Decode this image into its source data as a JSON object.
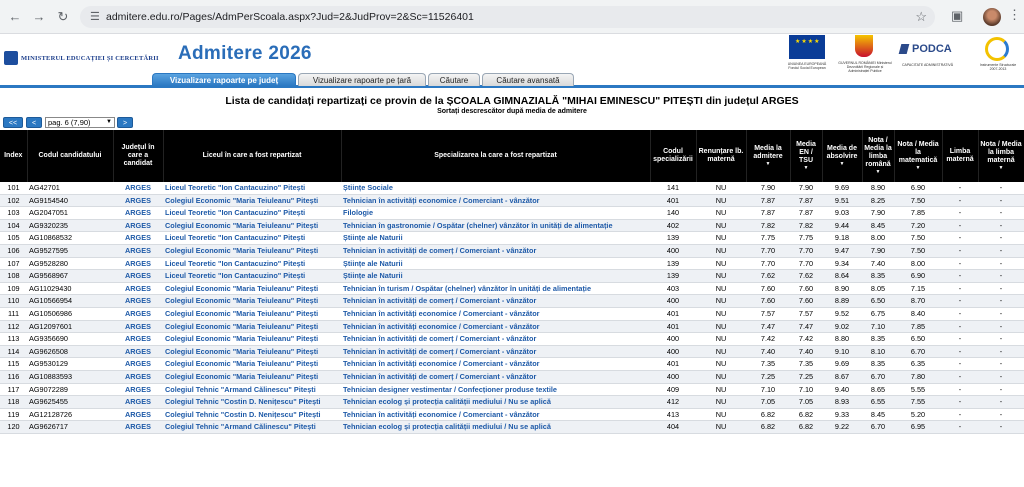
{
  "browser": {
    "url": "admitere.edu.ro/Pages/AdmPerScoala.aspx?Jud=2&JudProv=2&Sc=11526401"
  },
  "header": {
    "ministry": "MINISTERUL EDUCAȚIEI ȘI CERCETĂRII",
    "title": "Admitere 2026",
    "logo_eu_caption": "UNIUNEA EUROPEANĂ Fondul Social European",
    "logo_gov_caption": "GUVERNUL ROMÂNIEI Ministerul Dezvoltării Regionale și Administrației Publice",
    "logo_podca": "PODCA",
    "logo_podca_caption": "CAPACITATE ADMINISTRATIVĂ",
    "logo_inst_caption": "Instrumente Structurale 2007-2013"
  },
  "tabs": [
    {
      "label": "Vizualizare rapoarte pe județ",
      "active": true
    },
    {
      "label": "Vizualizare rapoarte pe țară",
      "active": false
    },
    {
      "label": "Căutare",
      "active": false
    },
    {
      "label": "Căutare avansată",
      "active": false
    }
  ],
  "list": {
    "title": "Lista de candidați repartizați ce provin de la ȘCOALA GIMNAZIALĂ \"MIHAI EMINESCU\" PITEȘTI din județul ARGES",
    "subtitle": "Sortați descrescător după media de admitere"
  },
  "pager": {
    "first": "<<",
    "prev": "<",
    "selected_page": "pag. 6 (7,90)",
    "next": ">"
  },
  "columns": [
    "Index",
    "Codul candidatului",
    "Județul în care a candidat",
    "Liceul în care a fost repartizat",
    "Specializarea la care a fost repartizat",
    "Codul specializării",
    "Renunțare lb. maternă",
    "Media la admitere",
    "Media EN / TSU",
    "Media de absolvire",
    "Nota / Media la limba română",
    "Nota / Media la matematică",
    "Limba maternă",
    "Nota / Media la limba maternă"
  ],
  "rows": [
    [
      "101",
      "AG42701",
      "ARGES",
      "Liceul Teoretic \"Ion Cantacuzino\" Pitești",
      "Științe Sociale",
      "141",
      "NU",
      "7.90",
      "7.90",
      "9.69",
      "8.90",
      "6.90",
      "-",
      "-"
    ],
    [
      "102",
      "AG9154540",
      "ARGES",
      "Colegiul Economic \"Maria Teiuleanu\" Pitești",
      "Tehnician în activități economice / Comerciant - vânzător",
      "401",
      "NU",
      "7.87",
      "7.87",
      "9.51",
      "8.25",
      "7.50",
      "-",
      "-"
    ],
    [
      "103",
      "AG2047051",
      "ARGES",
      "Liceul Teoretic \"Ion Cantacuzino\" Pitești",
      "Filologie",
      "140",
      "NU",
      "7.87",
      "7.87",
      "9.03",
      "7.90",
      "7.85",
      "-",
      "-"
    ],
    [
      "104",
      "AG9320235",
      "ARGES",
      "Colegiul Economic \"Maria Teiuleanu\" Pitești",
      "Tehnician în gastronomie / Ospătar (chelner) vânzător în unități de alimentație",
      "402",
      "NU",
      "7.82",
      "7.82",
      "9.44",
      "8.45",
      "7.20",
      "-",
      "-"
    ],
    [
      "105",
      "AG10868532",
      "ARGES",
      "Liceul Teoretic \"Ion Cantacuzino\" Pitești",
      "Științe ale Naturii",
      "139",
      "NU",
      "7.75",
      "7.75",
      "9.18",
      "8.00",
      "7.50",
      "-",
      "-"
    ],
    [
      "106",
      "AG9527595",
      "ARGES",
      "Colegiul Economic \"Maria Teiuleanu\" Pitești",
      "Tehnician în activități de comerț / Comerciant - vânzător",
      "400",
      "NU",
      "7.70",
      "7.70",
      "9.47",
      "7.90",
      "7.50",
      "-",
      "-"
    ],
    [
      "107",
      "AG9528280",
      "ARGES",
      "Liceul Teoretic \"Ion Cantacuzino\" Pitești",
      "Științe ale Naturii",
      "139",
      "NU",
      "7.70",
      "7.70",
      "9.34",
      "7.40",
      "8.00",
      "-",
      "-"
    ],
    [
      "108",
      "AG9568967",
      "ARGES",
      "Liceul Teoretic \"Ion Cantacuzino\" Pitești",
      "Științe ale Naturii",
      "139",
      "NU",
      "7.62",
      "7.62",
      "8.64",
      "8.35",
      "6.90",
      "-",
      "-"
    ],
    [
      "109",
      "AG11029430",
      "ARGES",
      "Colegiul Economic \"Maria Teiuleanu\" Pitești",
      "Tehnician în turism / Ospătar (chelner) vânzător în unități de alimentație",
      "403",
      "NU",
      "7.60",
      "7.60",
      "8.90",
      "8.05",
      "7.15",
      "-",
      "-"
    ],
    [
      "110",
      "AG10566954",
      "ARGES",
      "Colegiul Economic \"Maria Teiuleanu\" Pitești",
      "Tehnician în activități de comerț / Comerciant - vânzător",
      "400",
      "NU",
      "7.60",
      "7.60",
      "8.89",
      "6.50",
      "8.70",
      "-",
      "-"
    ],
    [
      "111",
      "AG10506986",
      "ARGES",
      "Colegiul Economic \"Maria Teiuleanu\" Pitești",
      "Tehnician în activități economice / Comerciant - vânzător",
      "401",
      "NU",
      "7.57",
      "7.57",
      "9.52",
      "6.75",
      "8.40",
      "-",
      "-"
    ],
    [
      "112",
      "AG12097601",
      "ARGES",
      "Colegiul Economic \"Maria Teiuleanu\" Pitești",
      "Tehnician în activități economice / Comerciant - vânzător",
      "401",
      "NU",
      "7.47",
      "7.47",
      "9.02",
      "7.10",
      "7.85",
      "-",
      "-"
    ],
    [
      "113",
      "AG9356690",
      "ARGES",
      "Colegiul Economic \"Maria Teiuleanu\" Pitești",
      "Tehnician în activități de comerț / Comerciant - vânzător",
      "400",
      "NU",
      "7.42",
      "7.42",
      "8.80",
      "8.35",
      "6.50",
      "-",
      "-"
    ],
    [
      "114",
      "AG9626508",
      "ARGES",
      "Colegiul Economic \"Maria Teiuleanu\" Pitești",
      "Tehnician în activități de comerț / Comerciant - vânzător",
      "400",
      "NU",
      "7.40",
      "7.40",
      "9.10",
      "8.10",
      "6.70",
      "-",
      "-"
    ],
    [
      "115",
      "AG9530129",
      "ARGES",
      "Colegiul Economic \"Maria Teiuleanu\" Pitești",
      "Tehnician în activități economice / Comerciant - vânzător",
      "401",
      "NU",
      "7.35",
      "7.35",
      "9.69",
      "8.35",
      "6.35",
      "-",
      "-"
    ],
    [
      "116",
      "AG10883593",
      "ARGES",
      "Colegiul Economic \"Maria Teiuleanu\" Pitești",
      "Tehnician în activități de comerț / Comerciant - vânzător",
      "400",
      "NU",
      "7.25",
      "7.25",
      "8.67",
      "6.70",
      "7.80",
      "-",
      "-"
    ],
    [
      "117",
      "AG9072289",
      "ARGES",
      "Colegiul Tehnic \"Armand Călinescu\" Pitești",
      "Tehnician designer vestimentar / Confecționer produse textile",
      "409",
      "NU",
      "7.10",
      "7.10",
      "9.40",
      "8.65",
      "5.55",
      "-",
      "-"
    ],
    [
      "118",
      "AG9625455",
      "ARGES",
      "Colegiul Tehnic \"Costin D. Nenițescu\" Pitești",
      "Tehnician ecolog și protecția calității mediului / Nu se aplică",
      "412",
      "NU",
      "7.05",
      "7.05",
      "8.93",
      "6.55",
      "7.55",
      "-",
      "-"
    ],
    [
      "119",
      "AG12128726",
      "ARGES",
      "Colegiul Tehnic \"Costin D. Nenițescu\" Pitești",
      "Tehnician în activități economice / Comerciant - vânzător",
      "413",
      "NU",
      "6.82",
      "6.82",
      "9.33",
      "8.45",
      "5.20",
      "-",
      "-"
    ],
    [
      "120",
      "AG9626717",
      "ARGES",
      "Colegiul Tehnic \"Armand Călinescu\" Pitești",
      "Tehnician ecolog și protecția calității mediului / Nu se aplică",
      "404",
      "NU",
      "6.82",
      "6.82",
      "9.22",
      "6.70",
      "6.95",
      "-",
      "-"
    ]
  ]
}
